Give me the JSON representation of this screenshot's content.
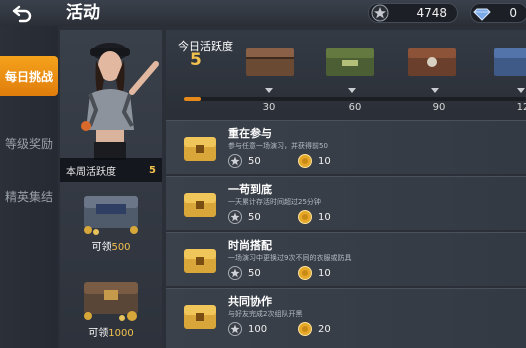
{
  "header": {
    "title": "活动",
    "merit_value": "4748",
    "diamond_value": "0"
  },
  "tabs": [
    {
      "label": "每日挑战"
    },
    {
      "label": "等级奖励"
    },
    {
      "label": "精英集结"
    }
  ],
  "week": {
    "label": "本周活跃度",
    "value": "5"
  },
  "week_rewards": [
    {
      "prefix": "可领",
      "value": "500"
    },
    {
      "prefix": "可领",
      "value": "1000"
    }
  ],
  "activity": {
    "title": "今日活跃度",
    "value": "5",
    "progress": 0.05,
    "milestones": [
      "30",
      "60",
      "90",
      "12"
    ]
  },
  "tasks": [
    {
      "name": "重在参与",
      "desc": "参与任意一场演习，并获得前50",
      "reward_points": "50",
      "reward_coin": "10"
    },
    {
      "name": "一苟到底",
      "desc": "一天累计存活时间超过25分钟",
      "reward_points": "50",
      "reward_coin": "10"
    },
    {
      "name": "时尚搭配",
      "desc": "一场演习中更换过9次不同的衣服或防具",
      "reward_points": "50",
      "reward_coin": "10"
    },
    {
      "name": "共同协作",
      "desc": "与好友完成2次组队开黑",
      "reward_points": "100",
      "reward_coin": "20"
    }
  ],
  "icons": {
    "back": "back-arrow-icon",
    "merit": "merit-star-icon",
    "diamond": "diamond-icon",
    "chest": "treasure-chest-icon",
    "coin": "gold-coin-icon"
  },
  "colors": {
    "accent": "#e8891c",
    "gold": "#f2c14e",
    "tab_active": "#f0961a"
  }
}
